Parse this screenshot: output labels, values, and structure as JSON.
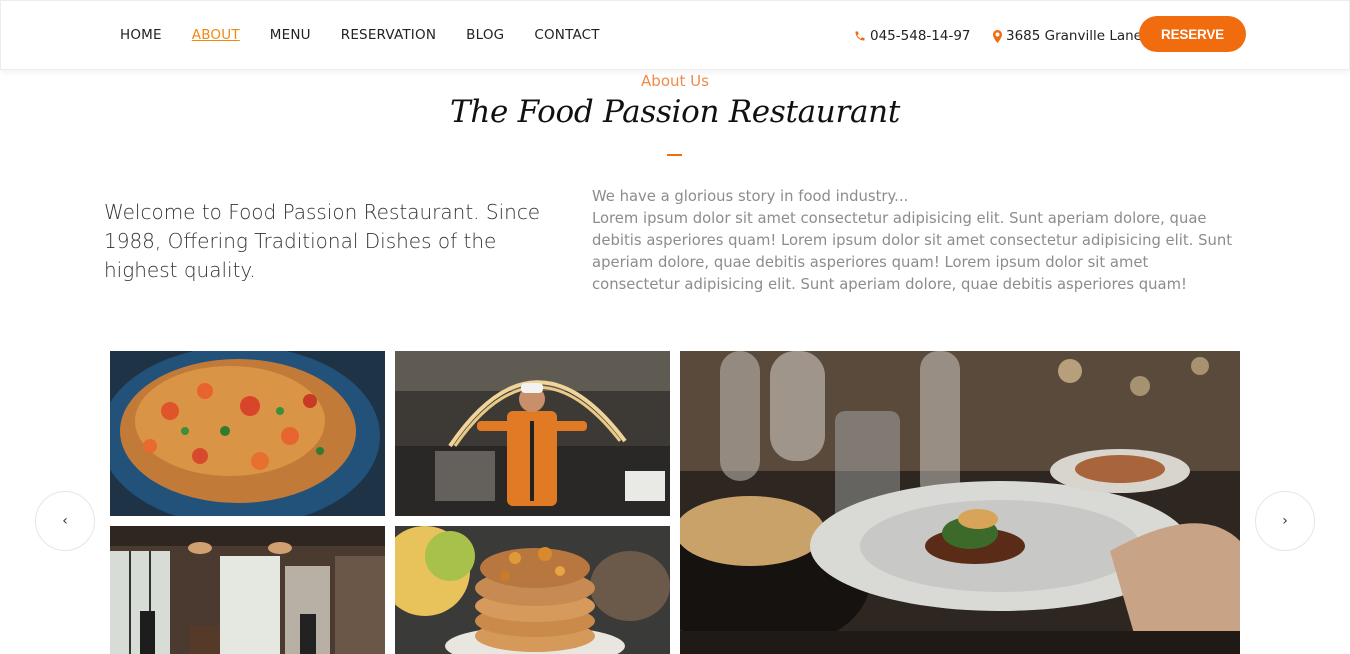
{
  "nav": {
    "items": [
      {
        "label": "HOME",
        "active": false
      },
      {
        "label": "ABOUT",
        "active": true
      },
      {
        "label": "MENU",
        "active": false
      },
      {
        "label": "RESERVATION",
        "active": false
      },
      {
        "label": "BLOG",
        "active": false
      },
      {
        "label": "CONTACT",
        "active": false
      }
    ],
    "phone": "045-548-14-97",
    "address": "3685 Granville Lane",
    "reserve_label": "RESERVE"
  },
  "about": {
    "eyebrow": "About Us",
    "title": "The Food Passion Restaurant",
    "lead": "Welcome to Food Passion Restaurant. Since 1988, Offering Traditional Dishes of the highest quality.",
    "story_heading": "We have a glorious story in food industry...",
    "story_body": "Lorem ipsum dolor sit amet consectetur adipisicing elit. Sunt aperiam dolore, quae debitis asperiores quam! Lorem ipsum dolor sit amet consectetur adipisicing elit. Sunt aperiam dolore, quae debitis asperiores quam! Lorem ipsum dolor sit amet consectetur adipisicing elit. Sunt aperiam dolore, quae debitis asperiores quam!"
  },
  "gallery": {
    "prev_label": "‹",
    "next_label": "›"
  },
  "colors": {
    "accent": "#f06c0f",
    "active_nav": "#ef8a10",
    "eyebrow": "#f08a4b",
    "muted_text": "#8c8c8c"
  }
}
